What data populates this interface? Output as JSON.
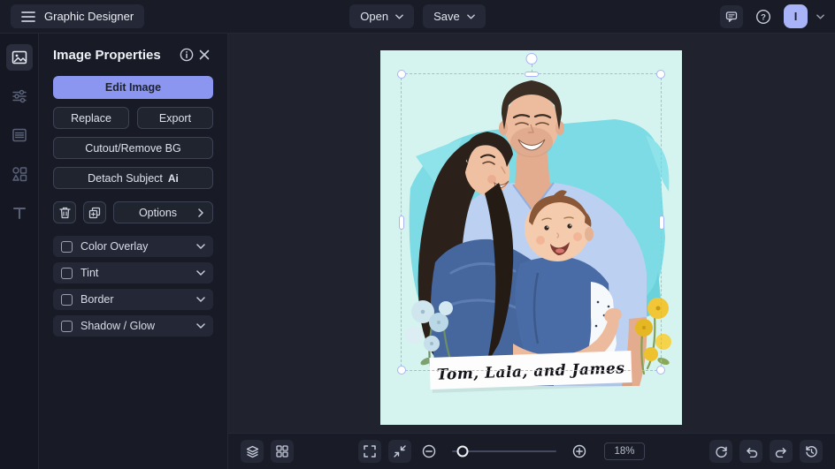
{
  "topbar": {
    "app_title": "Graphic Designer",
    "open_label": "Open",
    "save_label": "Save",
    "avatar_initial": "I"
  },
  "sidebar": {
    "icons": [
      "image",
      "adjustments",
      "pages",
      "shapes",
      "text"
    ],
    "active": "image"
  },
  "panel": {
    "title": "Image Properties",
    "edit_image_label": "Edit Image",
    "replace_label": "Replace",
    "export_label": "Export",
    "cutout_label": "Cutout/Remove BG",
    "detach_label": "Detach Subject",
    "detach_badge": "Ai",
    "options_label": "Options",
    "sections": [
      {
        "label": "Color Overlay",
        "checked": false
      },
      {
        "label": "Tint",
        "checked": false
      },
      {
        "label": "Border",
        "checked": false
      },
      {
        "label": "Shadow / Glow",
        "checked": false
      }
    ]
  },
  "canvas": {
    "caption": "Tom, Lala, and James"
  },
  "toolbar": {
    "zoom_level": "18%"
  },
  "colors": {
    "accent": "#8b96f0",
    "avatar": "#a9b3f7",
    "selection": "#a9b4f4",
    "artboard_bg": "#d6f4ef",
    "brush": "#7cdbe4"
  }
}
